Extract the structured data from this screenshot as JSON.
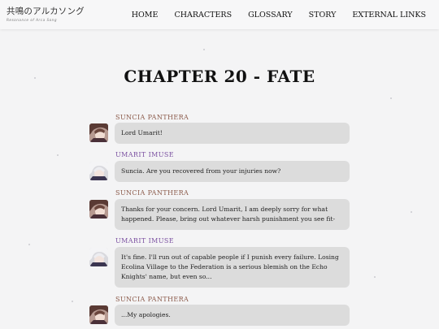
{
  "header": {
    "logo_title": "共鳴のアルカソング",
    "logo_subtitle": "Resonance of Arca Song",
    "nav": [
      {
        "label": "HOME"
      },
      {
        "label": "CHARACTERS"
      },
      {
        "label": "GLOSSARY"
      },
      {
        "label": "STORY"
      },
      {
        "label": "EXTERNAL LINKS"
      }
    ]
  },
  "chapter": {
    "title": "CHAPTER 20 - FATE"
  },
  "dialogue": [
    {
      "speaker": "SUNCIA PANTHERA",
      "character": "suncia",
      "text": "Lord Umarit!"
    },
    {
      "speaker": "UMARIT IMUSE",
      "character": "umarit",
      "text": "Suncia. Are you recovered from your injuries now?"
    },
    {
      "speaker": "SUNCIA PANTHERA",
      "character": "suncia",
      "text": "Thanks for your concern. Lord Umarit, I am deeply sorry for what happened. Please, bring out whatever harsh punishment you see fit-"
    },
    {
      "speaker": "UMARIT IMUSE",
      "character": "umarit",
      "text": "It's fine. I'll run out of capable people if I punish every failure. Losing Ecolina Village to the Federation is a serious blemish on the Echo Knights' name, but even so..."
    },
    {
      "speaker": "SUNCIA PANTHERA",
      "character": "suncia",
      "text": "...My apologies."
    }
  ],
  "colors": {
    "background": "#f4f4f5",
    "suncia_name": "#8b5a4a",
    "umarit_name": "#7a4fa0",
    "bubble": "#dcdcdc"
  }
}
